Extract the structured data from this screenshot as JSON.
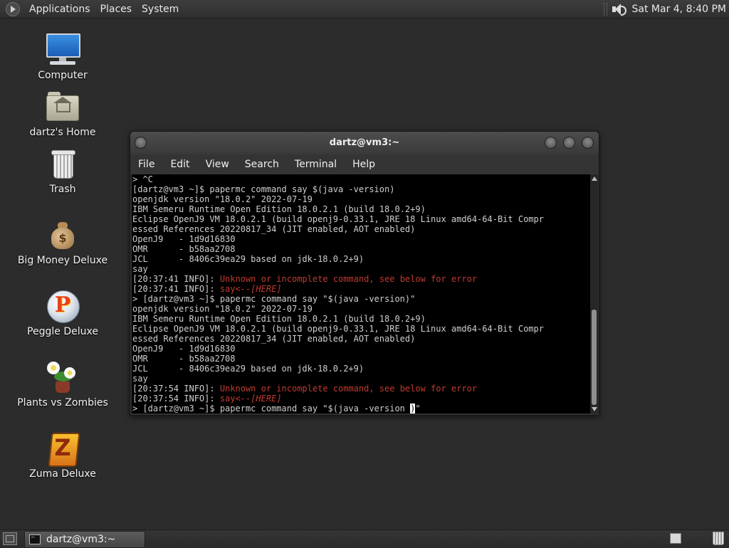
{
  "top_panel": {
    "menus": [
      "Applications",
      "Places",
      "System"
    ],
    "clock": "Sat Mar  4,  8:40 PM"
  },
  "desktop_icons": [
    {
      "label": "Computer",
      "icon": "computer-icon"
    },
    {
      "label": "dartz's Home",
      "icon": "home-folder-icon"
    },
    {
      "label": "Trash",
      "icon": "trash-icon"
    },
    {
      "label": "Big Money Deluxe",
      "icon": "money-bag-icon"
    },
    {
      "label": "Peggle Deluxe",
      "icon": "peggle-icon"
    },
    {
      "label": "Plants vs Zombies",
      "icon": "plants-vs-zombies-icon"
    },
    {
      "label": "Zuma Deluxe",
      "icon": "zuma-icon"
    }
  ],
  "terminal": {
    "title": "dartz@vm3:~",
    "menu": [
      "File",
      "Edit",
      "View",
      "Search",
      "Terminal",
      "Help"
    ],
    "lines": [
      "> ^C",
      "[dartz@vm3 ~]$ papermc command say $(java -version)",
      "openjdk version \"18.0.2\" 2022-07-19",
      "IBM Semeru Runtime Open Edition 18.0.2.1 (build 18.0.2+9)",
      "Eclipse OpenJ9 VM 18.0.2.1 (build openj9-0.33.1, JRE 18 Linux amd64-64-Bit Compr",
      "essed References 20220817_34 (JIT enabled, AOT enabled)",
      "OpenJ9   - 1d9d16830",
      "OMR      - b58aa2708",
      "JCL      - 8406c39ea29 based on jdk-18.0.2+9)",
      "say",
      "[20:37:41 INFO]: ",
      "[20:37:41 INFO]: ",
      "> [dartz@vm3 ~]$ papermc command say \"$(java -version)\"",
      "openjdk version \"18.0.2\" 2022-07-19",
      "IBM Semeru Runtime Open Edition 18.0.2.1 (build 18.0.2+9)",
      "Eclipse OpenJ9 VM 18.0.2.1 (build openj9-0.33.1, JRE 18 Linux amd64-64-Bit Compr",
      "essed References 20220817_34 (JIT enabled, AOT enabled)",
      "OpenJ9   - 1d9d16830",
      "OMR      - b58aa2708",
      "JCL      - 8406c39ea29 based on jdk-18.0.2+9)",
      "say",
      "[20:37:54 INFO]: ",
      "[20:37:54 INFO]: ",
      "> [dartz@vm3 ~]$ papermc command say \"$(java -version "
    ],
    "error_msg": "Unknown or incomplete command, see below for error",
    "say_cmd": "say",
    "here_marker": "<--[HERE]",
    "cursor_char": ")",
    "after_cursor": "\""
  },
  "bottom_panel": {
    "task_label": "dartz@vm3:~"
  }
}
